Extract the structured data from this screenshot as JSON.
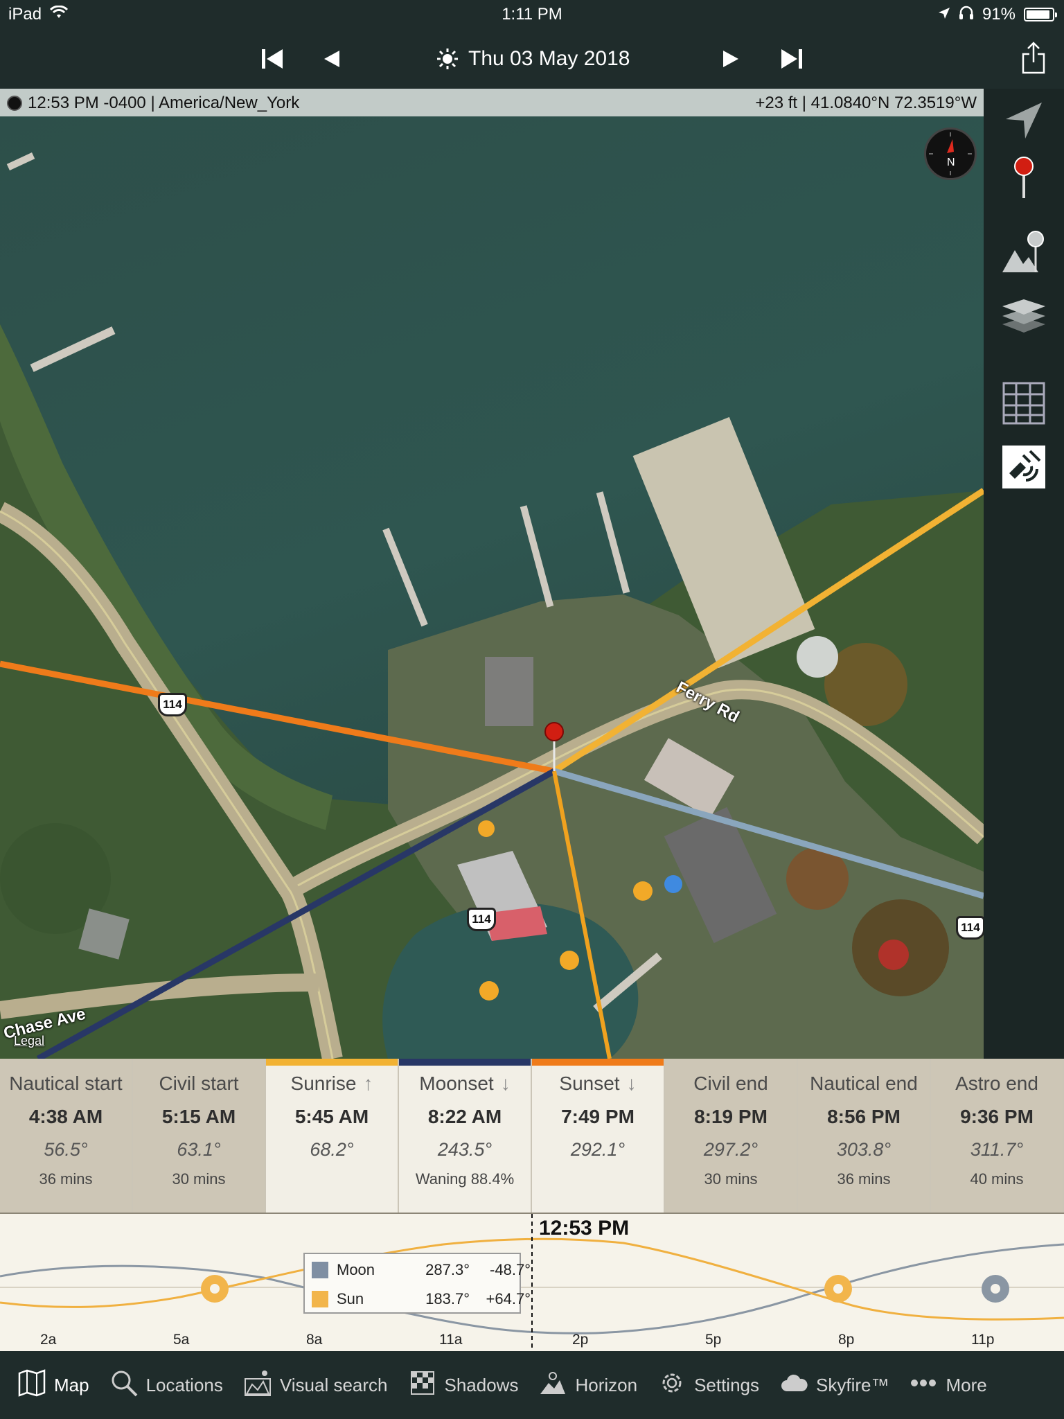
{
  "status_bar": {
    "device": "iPad",
    "time": "1:11 PM",
    "battery": "91%"
  },
  "nav": {
    "date": "Thu 03 May 2018"
  },
  "info_strip": {
    "left": "12:53 PM -0400 | America/New_York",
    "right": "+23 ft | 41.0840°N 72.3519°W"
  },
  "map": {
    "labels": {
      "road_shield_1": "114",
      "road_shield_2": "114",
      "road_shield_3": "114",
      "street_chase": "Chase Ave",
      "street_ferry": "Ferry Rd",
      "legal": "Legal"
    },
    "compass_letter": "N"
  },
  "events": [
    {
      "name": "Nautical start",
      "time": "4:38 AM",
      "angle": "56.5°",
      "sub": "36 mins",
      "arrow": "",
      "style": "dim",
      "bar": ""
    },
    {
      "name": "Civil start",
      "time": "5:15 AM",
      "angle": "63.1°",
      "sub": "30 mins",
      "arrow": "",
      "style": "dim",
      "bar": ""
    },
    {
      "name": "Sunrise",
      "time": "5:45 AM",
      "angle": "68.2°",
      "sub": "",
      "arrow": "↑",
      "style": "lite",
      "bar": "#f2b233"
    },
    {
      "name": "Moonset",
      "time": "8:22 AM",
      "angle": "243.5°",
      "sub": "Waning 88.4%",
      "arrow": "↓",
      "style": "lite",
      "bar": "#283766"
    },
    {
      "name": "Sunset",
      "time": "7:49 PM",
      "angle": "292.1°",
      "sub": "",
      "arrow": "↓",
      "style": "lite",
      "bar": "#ef7b1a"
    },
    {
      "name": "Civil end",
      "time": "8:19 PM",
      "angle": "297.2°",
      "sub": "30 mins",
      "arrow": "",
      "style": "dim",
      "bar": ""
    },
    {
      "name": "Nautical end",
      "time": "8:56 PM",
      "angle": "303.8°",
      "sub": "36 mins",
      "arrow": "",
      "style": "dim",
      "bar": ""
    },
    {
      "name": "Astro end",
      "time": "9:36 PM",
      "angle": "311.7°",
      "sub": "40 mins",
      "arrow": "",
      "style": "dim",
      "bar": ""
    }
  ],
  "timeline": {
    "now_label": "12:53 PM",
    "legend": {
      "moon": {
        "label": "Moon",
        "azimuth": "287.3°",
        "altitude": "-48.7°",
        "color": "#7f8fa3"
      },
      "sun": {
        "label": "Sun",
        "azimuth": "183.7°",
        "altitude": "+64.7°",
        "color": "#f2b54b"
      }
    },
    "ticks": [
      "2a",
      "5a",
      "8a",
      "11a",
      "2p",
      "5p",
      "8p",
      "11p"
    ]
  },
  "tabs": [
    {
      "label": "Map",
      "icon": "map-icon",
      "active": true
    },
    {
      "label": "Locations",
      "icon": "search-icon",
      "active": false
    },
    {
      "label": "Visual search",
      "icon": "visual-search-icon",
      "active": false
    },
    {
      "label": "Shadows",
      "icon": "shadows-icon",
      "active": false
    },
    {
      "label": "Horizon",
      "icon": "horizon-icon",
      "active": false
    },
    {
      "label": "Settings",
      "icon": "gear-icon",
      "active": false
    },
    {
      "label": "Skyfire™",
      "icon": "cloud-icon",
      "active": false
    },
    {
      "label": "More",
      "icon": "more-icon",
      "active": false
    }
  ],
  "colors": {
    "sunrise": "#f2b233",
    "sunset": "#ef7b1a",
    "moonrise": "#8aa6bd",
    "moonset": "#283766",
    "sun_now": "#f0a21f"
  }
}
